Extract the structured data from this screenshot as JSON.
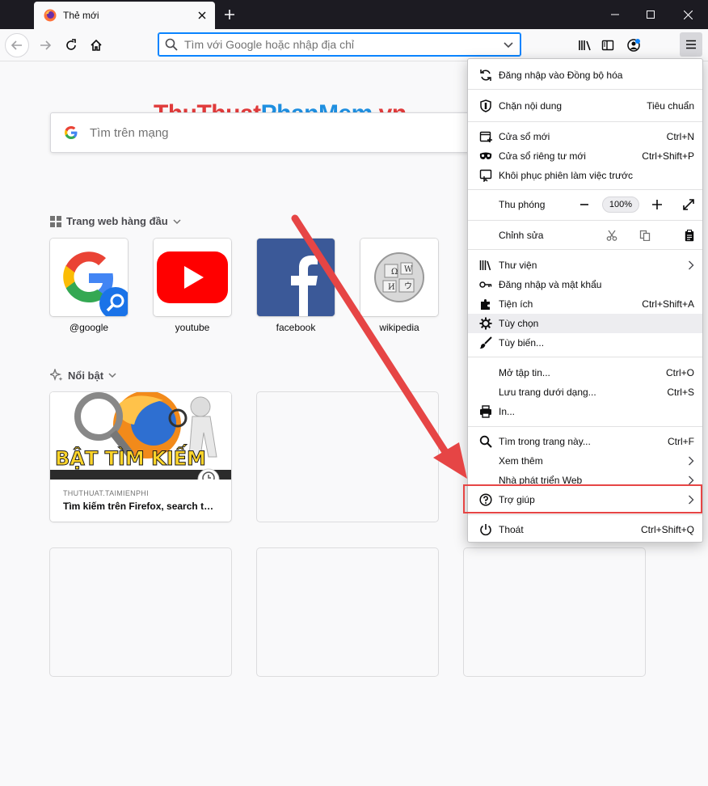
{
  "tab": {
    "title": "Thẻ mới"
  },
  "urlbar": {
    "placeholder": "Tìm với Google hoặc nhập địa chỉ"
  },
  "watermark": {
    "part1": "ThuThuat",
    "part2": "PhanMem",
    "part3": ".vn"
  },
  "search": {
    "placeholder": "Tìm trên mạng"
  },
  "top_sites": {
    "heading": "Trang web hàng đầu",
    "items": [
      {
        "label": "@google",
        "icon": "google-icon"
      },
      {
        "label": "youtube",
        "icon": "youtube-icon"
      },
      {
        "label": "facebook",
        "icon": "facebook-icon"
      },
      {
        "label": "wikipedia",
        "icon": "wikipedia-icon"
      }
    ]
  },
  "highlights": {
    "heading": "Nổi bật",
    "cards": [
      {
        "thumb_text": "BẬT TÌM KIẾM",
        "source": "THUTHUAT.TAIMIENPHI",
        "title": "Tìm kiếm trên Firefox, search từ k..."
      }
    ]
  },
  "menu": {
    "sync": "Đăng nhập vào Đồng bộ hóa",
    "blocking": {
      "label": "Chặn nội dung",
      "value": "Tiêu chuẩn"
    },
    "new_window": {
      "label": "Cửa sổ mới",
      "shortcut": "Ctrl+N"
    },
    "private_window": {
      "label": "Cửa sổ riêng tư mới",
      "shortcut": "Ctrl+Shift+P"
    },
    "restore": {
      "label": "Khôi phục phiên làm việc trước"
    },
    "zoom": {
      "label": "Thu phóng",
      "value": "100%"
    },
    "edit": {
      "label": "Chỉnh sửa"
    },
    "library": {
      "label": "Thư viện"
    },
    "logins": {
      "label": "Đăng nhập và mật khẩu"
    },
    "addons": {
      "label": "Tiện ích",
      "shortcut": "Ctrl+Shift+A"
    },
    "options": {
      "label": "Tùy chọn"
    },
    "customize": {
      "label": "Tùy biến..."
    },
    "open_file": {
      "label": "Mở tập tin...",
      "shortcut": "Ctrl+O"
    },
    "save_page": {
      "label": "Lưu trang dưới dạng...",
      "shortcut": "Ctrl+S"
    },
    "print": {
      "label": "In..."
    },
    "find": {
      "label": "Tìm trong trang này...",
      "shortcut": "Ctrl+F"
    },
    "more": {
      "label": "Xem thêm"
    },
    "webdev": {
      "label": "Nhà phát triển Web"
    },
    "help": {
      "label": "Trợ giúp"
    },
    "quit": {
      "label": "Thoát",
      "shortcut": "Ctrl+Shift+Q"
    }
  },
  "colors": {
    "accent": "#0a84ff",
    "annotation": "#e64545"
  }
}
